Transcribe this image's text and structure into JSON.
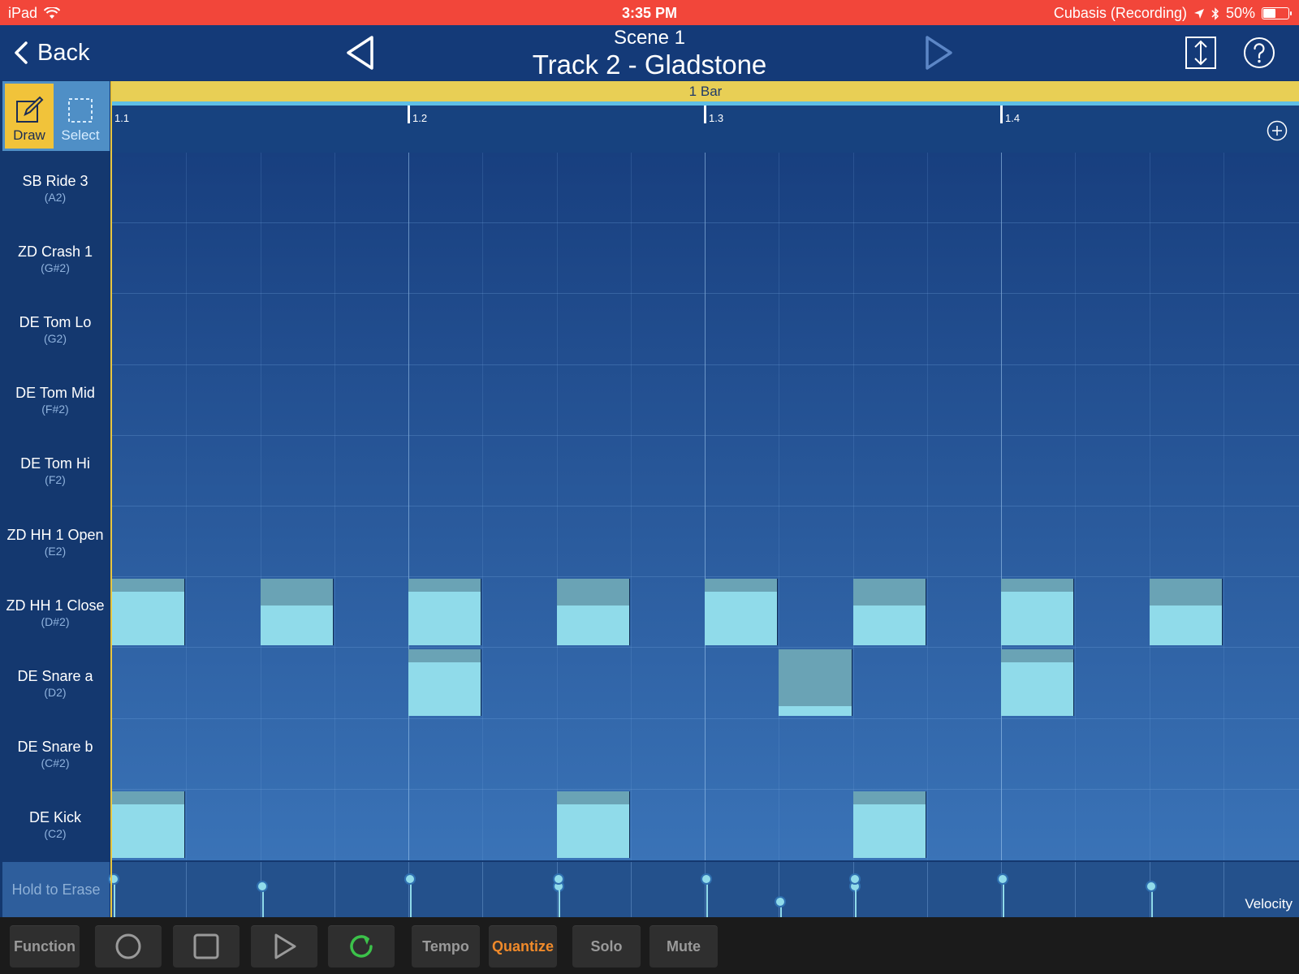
{
  "status_bar": {
    "device": "iPad",
    "time": "3:35 PM",
    "app_status": "Cubasis (Recording)",
    "battery": "50%",
    "battery_level": 0.5
  },
  "nav": {
    "back_label": "Back",
    "scene": "Scene  1",
    "track": "Track 2 - Gladstone"
  },
  "tools": [
    {
      "label": "Draw",
      "active": true
    },
    {
      "label": "Select",
      "active": false
    }
  ],
  "ruler": {
    "bar_label": "1 Bar",
    "markers": [
      "1.1",
      "1.2",
      "1.3",
      "1.4"
    ]
  },
  "pads": [
    {
      "name": "SB Ride 3",
      "note": "(A2)"
    },
    {
      "name": "ZD Crash 1",
      "note": "(G#2)"
    },
    {
      "name": "DE Tom Lo",
      "note": "(G2)"
    },
    {
      "name": "DE Tom Mid",
      "note": "(F#2)"
    },
    {
      "name": "DE Tom Hi",
      "note": "(F2)"
    },
    {
      "name": "ZD HH 1 Open",
      "note": "(E2)"
    },
    {
      "name": "ZD HH 1 Close",
      "note": "(D#2)"
    },
    {
      "name": "DE Snare a",
      "note": "(D2)"
    },
    {
      "name": "DE Snare b",
      "note": "(C#2)"
    },
    {
      "name": "DE Kick",
      "note": "(C2)"
    }
  ],
  "grid": {
    "steps": 16,
    "notes": [
      {
        "row": 6,
        "step": 0,
        "velocity": 0.8
      },
      {
        "row": 6,
        "step": 2,
        "velocity": 0.6
      },
      {
        "row": 6,
        "step": 4,
        "velocity": 0.8
      },
      {
        "row": 6,
        "step": 6,
        "velocity": 0.6
      },
      {
        "row": 6,
        "step": 8,
        "velocity": 0.8
      },
      {
        "row": 6,
        "step": 10,
        "velocity": 0.6
      },
      {
        "row": 6,
        "step": 12,
        "velocity": 0.8
      },
      {
        "row": 6,
        "step": 14,
        "velocity": 0.6
      },
      {
        "row": 7,
        "step": 4,
        "velocity": 0.8
      },
      {
        "row": 7,
        "step": 9,
        "velocity": 0.15
      },
      {
        "row": 7,
        "step": 12,
        "velocity": 0.8
      },
      {
        "row": 9,
        "step": 0,
        "velocity": 0.8
      },
      {
        "row": 9,
        "step": 6,
        "velocity": 0.8
      },
      {
        "row": 9,
        "step": 10,
        "velocity": 0.8
      }
    ]
  },
  "velocity_lane": {
    "erase_label": "Hold to Erase",
    "label": "Velocity"
  },
  "transport": {
    "function": "Function",
    "tempo": "Tempo",
    "quantize": "Quantize",
    "solo": "Solo",
    "mute": "Mute"
  },
  "colors": {
    "status_bar": "#f2463a",
    "accent_draw": "#f1c33a",
    "note": "#90dbea",
    "loop_green": "#3cc24a",
    "quantize_orange": "#f08a2a"
  }
}
